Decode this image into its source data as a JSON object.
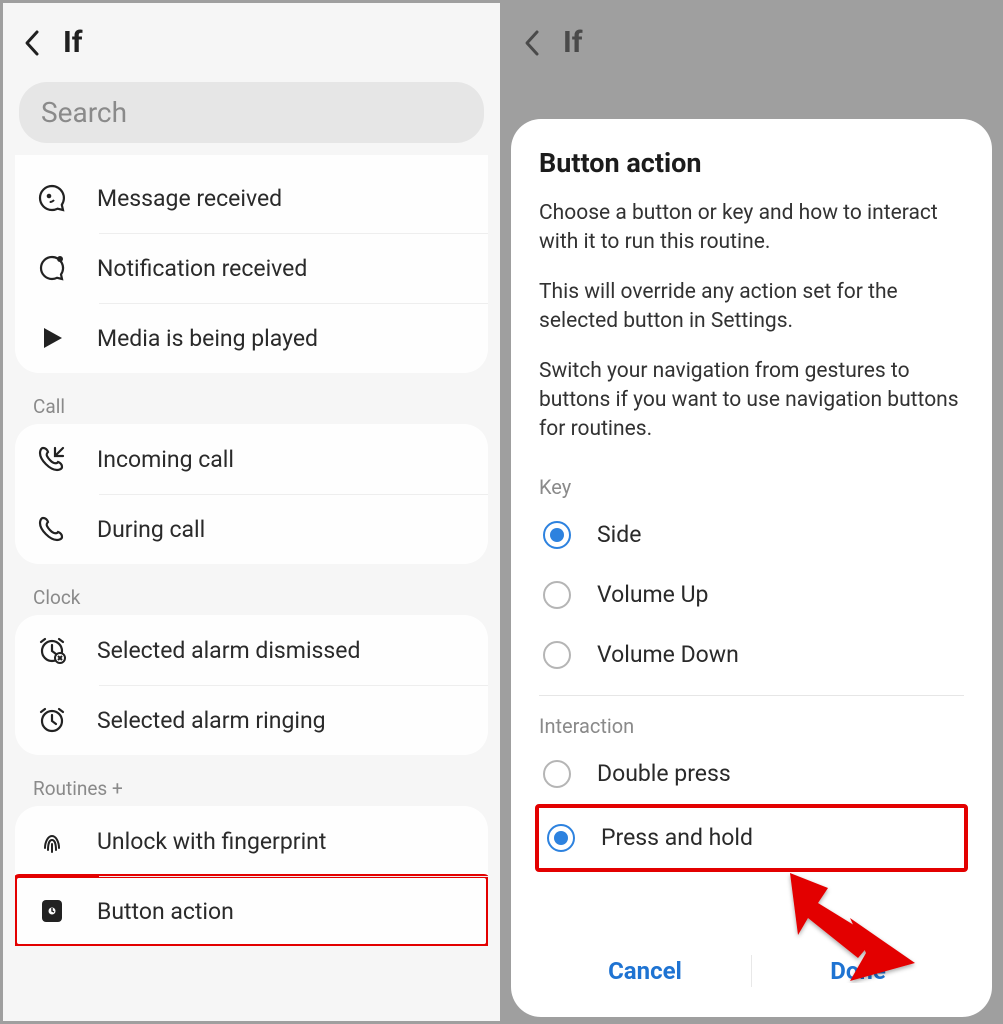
{
  "left": {
    "header_title": "If",
    "search_placeholder": "Search",
    "section1": {
      "items": [
        {
          "label": "Message received"
        },
        {
          "label": "Notification received"
        },
        {
          "label": "Media is being played"
        }
      ]
    },
    "section_call_label": "Call",
    "section_call": {
      "items": [
        {
          "label": "Incoming call"
        },
        {
          "label": "During call"
        }
      ]
    },
    "section_clock_label": "Clock",
    "section_clock": {
      "items": [
        {
          "label": "Selected alarm dismissed"
        },
        {
          "label": "Selected alarm ringing"
        }
      ]
    },
    "section_routines_label": "Routines +",
    "section_routines": {
      "items": [
        {
          "label": "Unlock with fingerprint"
        },
        {
          "label": "Button action"
        }
      ]
    }
  },
  "right": {
    "header_title": "If",
    "sheet_title": "Button action",
    "desc1": "Choose a button or key and how to interact with it to run this routine.",
    "desc2": "This will override any action set for the selected button in Settings.",
    "desc3": "Switch your navigation from gestures to buttons if you want to use navigation buttons for routines.",
    "key_label": "Key",
    "keys": [
      {
        "label": "Side",
        "checked": true
      },
      {
        "label": "Volume Up",
        "checked": false
      },
      {
        "label": "Volume Down",
        "checked": false
      }
    ],
    "interaction_label": "Interaction",
    "interactions": [
      {
        "label": "Double press",
        "checked": false
      },
      {
        "label": "Press and hold",
        "checked": true
      }
    ],
    "footer": {
      "cancel": "Cancel",
      "done": "Done"
    }
  }
}
